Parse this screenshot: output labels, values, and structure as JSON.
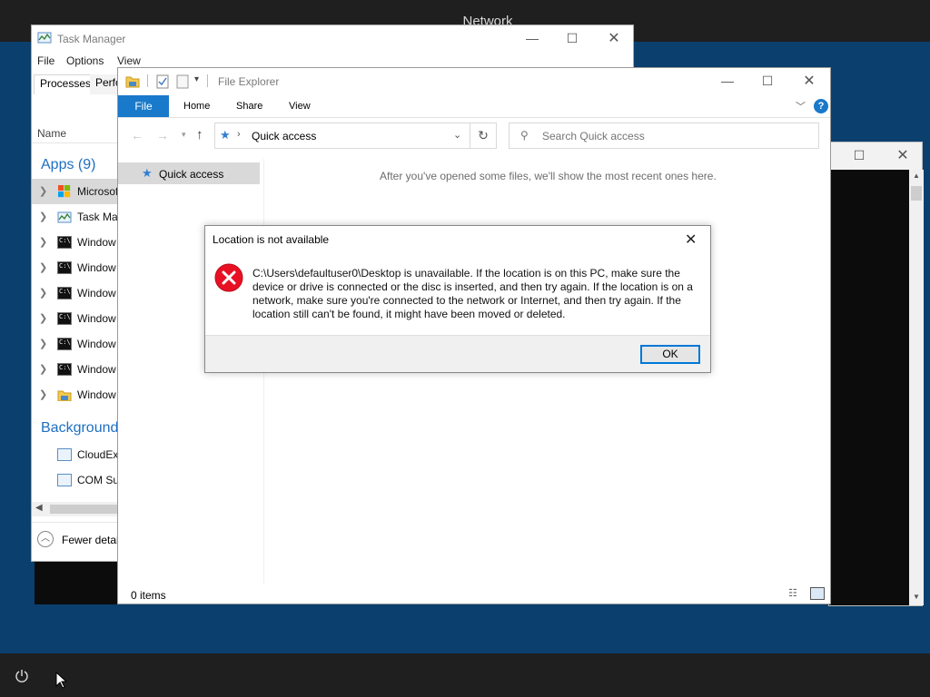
{
  "top_bar": {
    "title": "Network"
  },
  "task_manager": {
    "title": "Task Manager",
    "menu": [
      "File",
      "Options",
      "View"
    ],
    "tabs": [
      "Processes",
      "Perfo"
    ],
    "column_name": "Name",
    "groups": {
      "apps": "Apps (9)",
      "background": "Background"
    },
    "apps": [
      "Microsof",
      "Task Man",
      "Window",
      "Window",
      "Window",
      "Window",
      "Window",
      "Window",
      "Window"
    ],
    "background": [
      "CloudEx",
      "COM Su"
    ],
    "fewer_details": "Fewer detail"
  },
  "file_explorer": {
    "title": "File Explorer",
    "tabs": {
      "file": "File",
      "home": "Home",
      "share": "Share",
      "view": "View"
    },
    "address": "Quick access",
    "search_placeholder": "Search Quick access",
    "nav": {
      "quick_access": "Quick access"
    },
    "empty_message": "After you've opened some files, we'll show the most recent ones here.",
    "status": "0 items"
  },
  "dialog": {
    "title": "Location is not available",
    "message": "C:\\Users\\defaultuser0\\Desktop is unavailable. If the location is on this PC, make sure the device or drive is connected or the disc is inserted, and then try again. If the location is on a network, make sure you're connected to the network or Internet, and then try again. If the location still can't be found, it might have been moved or deleted.",
    "ok_label": "OK"
  },
  "colors": {
    "accent": "#1979ca",
    "error": "#e81123",
    "desktop": "#0b3f6e"
  },
  "icons": [
    "minimize-icon",
    "maximize-icon",
    "close-icon",
    "error-icon",
    "star-icon",
    "search-icon",
    "refresh-icon",
    "help-icon",
    "power-icon"
  ]
}
